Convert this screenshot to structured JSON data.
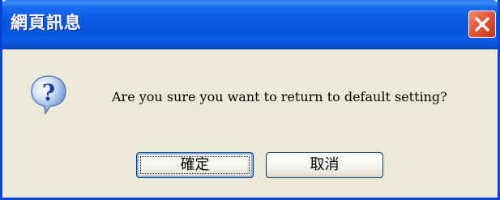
{
  "window": {
    "title": "網頁訊息"
  },
  "dialog": {
    "icon": "question-icon",
    "message": "Are you sure you want to return to default setting?"
  },
  "buttons": {
    "ok_label": "確定",
    "cancel_label": "取消"
  },
  "colors": {
    "titlebar_blue": "#0a58e2",
    "dialog_background": "#ece9d8",
    "close_button_red": "#e2573a"
  }
}
